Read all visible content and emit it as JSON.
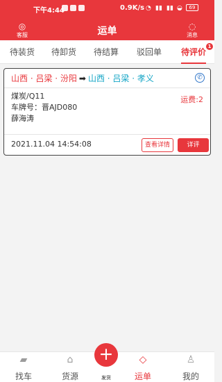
{
  "status_bar": {
    "time": "下午4:44",
    "network_speed": "0.9K/s",
    "battery": "69"
  },
  "header": {
    "title": "运单",
    "left_label": "客服",
    "right_label": "消息"
  },
  "tabs": [
    {
      "label": "待装货"
    },
    {
      "label": "待卸货"
    },
    {
      "label": "待结算"
    },
    {
      "label": "驳回单"
    },
    {
      "label": "待评价",
      "badge": "1"
    }
  ],
  "order": {
    "route_from": "山西 · 吕梁 · 汾阳",
    "route_to": "山西 · 吕梁 · 孝义",
    "goods": "煤炭/Q11",
    "plate_label": "车牌号：",
    "plate": "晋AJD080",
    "driver": "薛海涛",
    "fee": "运费:2",
    "date": "2021.11.04 14:54:08",
    "detail_button": "查看详情",
    "review_button": "详评"
  },
  "bottom_nav": {
    "items": [
      {
        "label": "找车"
      },
      {
        "label": "货源"
      },
      {
        "label": "运单"
      },
      {
        "label": "我的"
      }
    ],
    "publish_label": "发货"
  }
}
